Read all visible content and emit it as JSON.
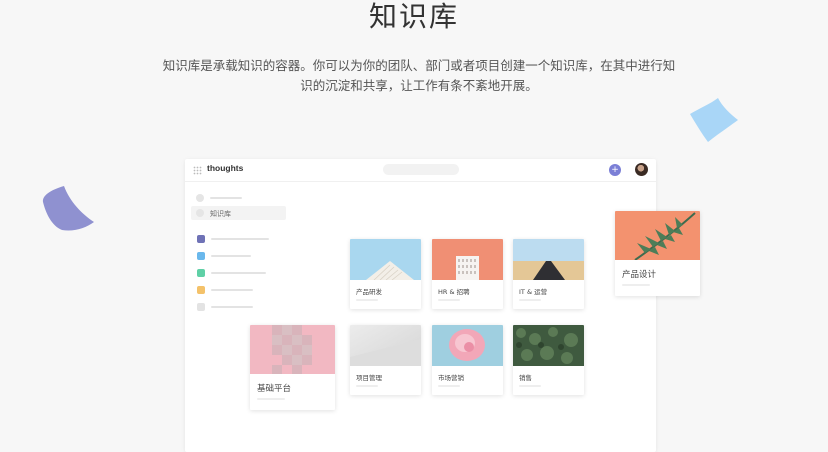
{
  "header": {
    "title": "知识库",
    "description_line1": "知识库是承载知识的容器。你可以为你的团队、部门或者项目创建一个知识库，在其中进行知",
    "description_line2": "识的沉淀和共享，让工作有条不紊地开展。"
  },
  "app": {
    "brand": "thoughts",
    "add_button_label": "+",
    "sidebar": {
      "active_label": "知识库",
      "color_items": [
        "#6f72b6",
        "#6ab8ec",
        "#5fd0a6",
        "#f4c26a",
        "#e3e3e3"
      ]
    },
    "cards": [
      {
        "label": "产品研发",
        "image": "building-sky"
      },
      {
        "label": "HR & 招聘",
        "image": "white-building-coral"
      },
      {
        "label": "IT & 运营",
        "image": "desert-road"
      },
      {
        "label": "项目管理",
        "image": "grey-wall"
      },
      {
        "label": "市场营销",
        "image": "pink-rose"
      },
      {
        "label": "销售",
        "image": "green-forest"
      }
    ],
    "floating_cards": [
      {
        "label": "产品设计",
        "image": "palm-leaf-coral"
      },
      {
        "label": "基础平台",
        "image": "pink-pixel-glass"
      }
    ]
  },
  "colors": {
    "accent": "#7b7fd6",
    "deco_left": "#8f91d0",
    "deco_right": "#a9d6f7"
  }
}
